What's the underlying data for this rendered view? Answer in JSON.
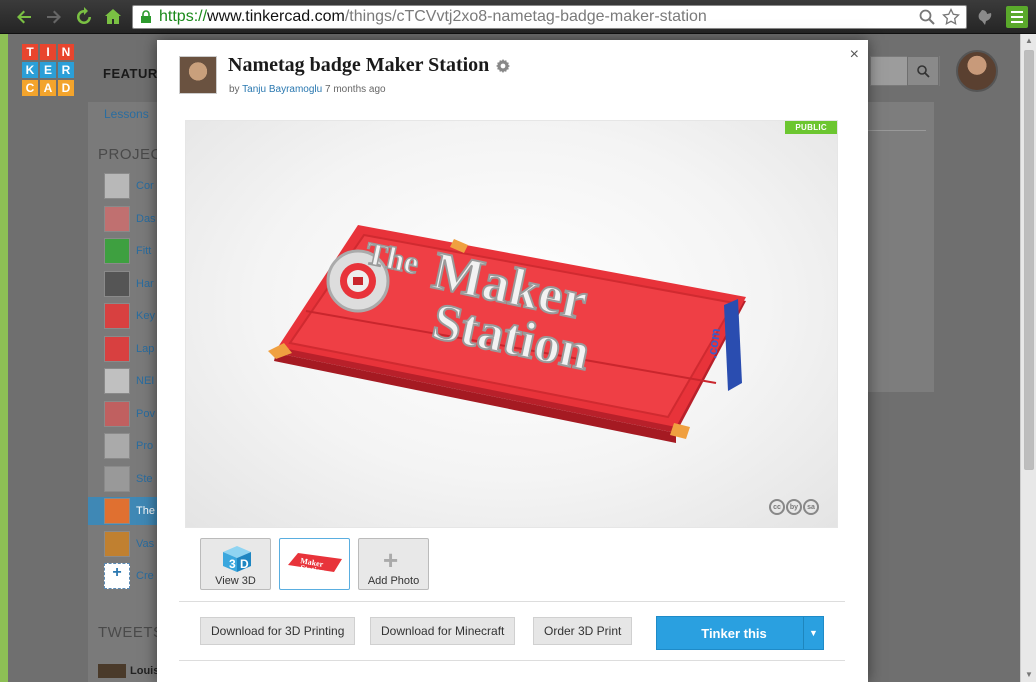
{
  "browser": {
    "url_scheme": "https://",
    "url_host": "www.tinkercad.com",
    "url_path": "/things/cTCVvtj2xo8-nametag-badge-maker-station"
  },
  "site": {
    "logo_letters": [
      "T",
      "I",
      "N",
      "K",
      "E",
      "R",
      "C",
      "A",
      "D"
    ],
    "logo_colors": [
      "#e8452e",
      "#e8452e",
      "#e8452e",
      "#2b9fd8",
      "#2b9fd8",
      "#2b9fd8",
      "#f3a42c",
      "#f3a42c",
      "#f3a42c"
    ],
    "nav_features": "FEATUR",
    "lessons_link": "Lessons",
    "projects_heading": "PROJEC",
    "tweets_heading": "TWEETS",
    "tweet_user": "Louis",
    "projects": [
      {
        "label": "Cor"
      },
      {
        "label": "Das"
      },
      {
        "label": "Fitt"
      },
      {
        "label": "Har"
      },
      {
        "label": "Key"
      },
      {
        "label": "Lap"
      },
      {
        "label": "NEI"
      },
      {
        "label": "Pov"
      },
      {
        "label": "Pro"
      },
      {
        "label": "Ste"
      },
      {
        "label": "The"
      },
      {
        "label": "Vas"
      },
      {
        "label": "Cre"
      }
    ]
  },
  "modal": {
    "title": "Nametag badge Maker Station",
    "by_prefix": "by",
    "author": "Tanju Bayramoglu",
    "time_ago": "7 months ago",
    "close_label": "×",
    "badge": "PUBLIC",
    "cc_icons": [
      "cc",
      "by",
      "sa"
    ],
    "thumbnails": [
      {
        "label": "View 3D"
      },
      {
        "label": ""
      },
      {
        "label": "Add Photo"
      }
    ],
    "actions": {
      "download_3d": "Download for 3D Printing",
      "download_minecraft": "Download for Minecraft",
      "order_print": "Order 3D Print",
      "tinker_this": "Tinker this"
    },
    "model_text": {
      "line1": "The",
      "line2": "Maker",
      "line3": "Station",
      "suffix": ".com"
    },
    "colors": {
      "accent": "#2aa0e0",
      "public_badge": "#6cc630",
      "model_red": "#e8333a",
      "model_blue": "#2a4db0"
    }
  }
}
